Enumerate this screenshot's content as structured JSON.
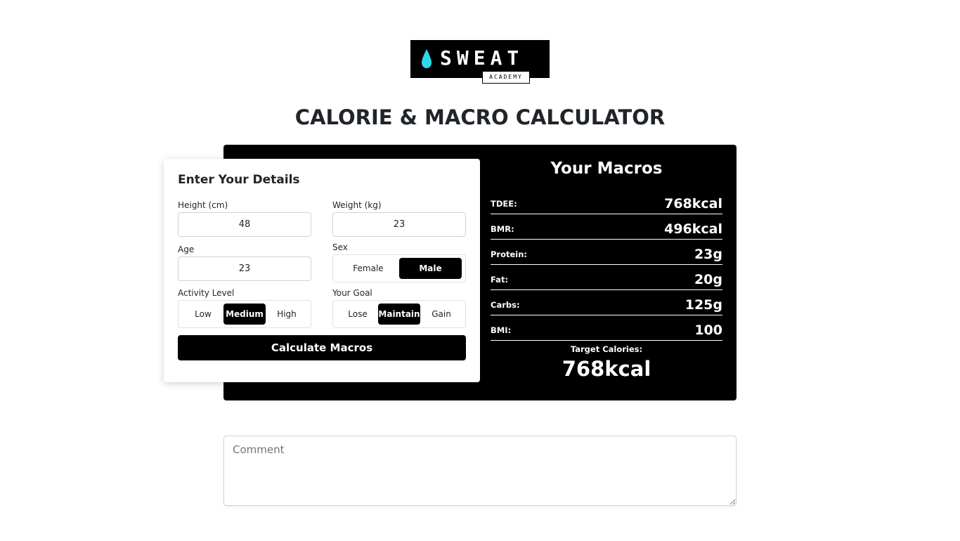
{
  "logo": {
    "brand": "SWEAT",
    "sub": "ACADEMY",
    "drop_color": "#2fd8e6"
  },
  "page_title": "CALORIE & MACRO CALCULATOR",
  "form": {
    "title": "Enter Your Details",
    "height": {
      "label": "Height (cm)",
      "value": "48"
    },
    "weight": {
      "label": "Weight (kg)",
      "value": "23"
    },
    "age": {
      "label": "Age",
      "value": "23"
    },
    "sex": {
      "label": "Sex",
      "options": [
        "Female",
        "Male"
      ],
      "selected": "Male"
    },
    "activity": {
      "label": "Activity Level",
      "options": [
        "Low",
        "Medium",
        "High"
      ],
      "selected": "Medium"
    },
    "goal": {
      "label": "Your Goal",
      "options": [
        "Lose",
        "Maintain",
        "Gain"
      ],
      "selected": "Maintain"
    },
    "calculate_label": "Calculate Macros"
  },
  "macros": {
    "title": "Your Macros",
    "rows": [
      {
        "label": "TDEE:",
        "value": "768kcal"
      },
      {
        "label": "BMR:",
        "value": "496kcal"
      },
      {
        "label": "Protein:",
        "value": "23g"
      },
      {
        "label": "Fat:",
        "value": "20g"
      },
      {
        "label": "Carbs:",
        "value": "125g"
      },
      {
        "label": "BMI:",
        "value": "100"
      }
    ],
    "target_label": "Target Calories:",
    "target_value": "768kcal"
  },
  "comment": {
    "placeholder": "Comment",
    "value": ""
  }
}
